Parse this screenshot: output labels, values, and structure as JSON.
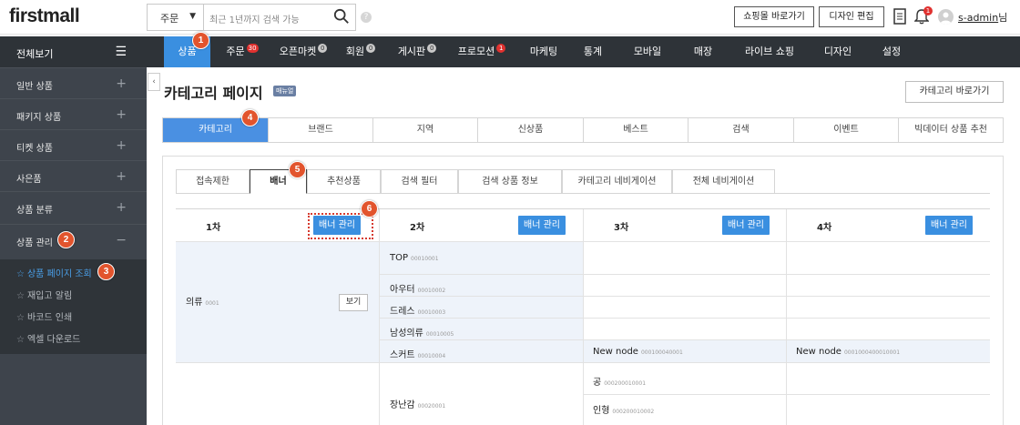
{
  "header": {
    "logo": "firstmall",
    "search_select": "주문",
    "search_placeholder": "최근 1년까지 검색 가능",
    "help": "?",
    "shop_button": "쇼핑몰 바로가기",
    "design_button": "디자인 편집",
    "notification_count": "1",
    "username": "s-admin",
    "username_suffix": "님"
  },
  "sidebar": {
    "all_label": "전체보기",
    "items": [
      {
        "label": "일반 상품",
        "toggle": "+"
      },
      {
        "label": "패키지 상품",
        "toggle": "+"
      },
      {
        "label": "티켓 상품",
        "toggle": "+"
      },
      {
        "label": "사은품",
        "toggle": "+"
      },
      {
        "label": "상품 분류",
        "toggle": "+"
      },
      {
        "label": "상품 관리",
        "toggle": "−"
      }
    ],
    "sub_items": [
      {
        "label": "상품 페이지 조회",
        "active": true
      },
      {
        "label": "재입고 알림",
        "active": false
      },
      {
        "label": "바코드 인쇄",
        "active": false
      },
      {
        "label": "엑셀 다운로드",
        "active": false
      }
    ],
    "collapse": "‹"
  },
  "topnav": {
    "items": [
      {
        "label": "상품",
        "badge": ""
      },
      {
        "label": "주문",
        "badge": "30"
      },
      {
        "label": "오픈마켓",
        "badge": "0"
      },
      {
        "label": "회원",
        "badge": "0"
      },
      {
        "label": "게시판",
        "badge": "0"
      },
      {
        "label": "프로모션",
        "badge": "1"
      },
      {
        "label": "마케팅",
        "badge": ""
      },
      {
        "label": "통계",
        "badge": ""
      },
      {
        "label": "모바일",
        "badge": ""
      },
      {
        "label": "매장",
        "badge": ""
      },
      {
        "label": "라이브 쇼핑",
        "badge": ""
      },
      {
        "label": "디자인",
        "badge": ""
      },
      {
        "label": "설정",
        "badge": ""
      }
    ]
  },
  "page": {
    "title": "카테고리 페이지",
    "manual_badge": "매뉴얼",
    "goto_button": "카테고리 바로가기"
  },
  "tabs_primary": [
    "카테고리",
    "브랜드",
    "지역",
    "신상품",
    "베스트",
    "검색",
    "이벤트",
    "빅데이터 상품 추천"
  ],
  "tabs_secondary": [
    "접속제한",
    "배너",
    "추천상품",
    "검색 필터",
    "검색 상품 정보",
    "카테고리 네비게이션",
    "전체 네비게이션"
  ],
  "grid": {
    "columns": [
      {
        "label": "1차",
        "button": "배너 관리"
      },
      {
        "label": "2차",
        "button": "배너 관리"
      },
      {
        "label": "3차",
        "button": "배너 관리"
      },
      {
        "label": "4차",
        "button": "배너 관리"
      }
    ],
    "level1": [
      {
        "name": "의류",
        "code": "0001",
        "button": "보기"
      },
      {
        "name": "장난감",
        "code": "0002",
        "button": ""
      }
    ],
    "level2": [
      {
        "name": "TOP",
        "code": "00010001"
      },
      {
        "name": "아우터",
        "code": "00010002"
      },
      {
        "name": "드레스",
        "code": "00010003"
      },
      {
        "name": "남성의류",
        "code": "00010005"
      },
      {
        "name": "스커트",
        "code": "00010004"
      },
      {
        "name": "장난감",
        "code": "00020001"
      }
    ],
    "level3": [
      {
        "name": "New node",
        "code": "000100040001"
      },
      {
        "name": "공",
        "code": "000200010001"
      },
      {
        "name": "인형",
        "code": "000200010002"
      }
    ],
    "level4": [
      {
        "name": "New node",
        "code": "0001000400010001"
      }
    ]
  },
  "markers": [
    "1",
    "2",
    "3",
    "4",
    "5",
    "6"
  ],
  "colors": {
    "accent": "#3a8fe0",
    "marker": "#e2542d",
    "sidebar": "#3e444c",
    "nav": "#2e3338",
    "badge_red": "#e0312f"
  }
}
